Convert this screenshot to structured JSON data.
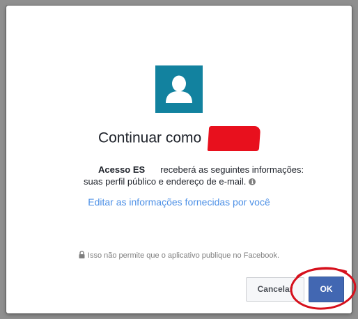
{
  "dialog": {
    "title_prefix": "Continuar como",
    "app_name": "Acesso ES",
    "permission_text": "receberá as seguintes informações:",
    "permission_detail": "suas perfil público e endereço de e-mail.",
    "info_icon": "i",
    "edit_link": "Editar as informações fornecidas por você",
    "notice": "Isso não permite que o aplicativo publique no Facebook.",
    "cancel_label": "Cancelar",
    "ok_label": "OK"
  },
  "icons": {
    "avatar": "user-silhouette-icon",
    "info": "info-icon",
    "lock": "lock-icon"
  },
  "colors": {
    "avatar_bg": "#12829f",
    "link": "#4d90e6",
    "primary_button": "#4267b2",
    "redaction": "#e8101d",
    "annotation": "#d6101c"
  }
}
